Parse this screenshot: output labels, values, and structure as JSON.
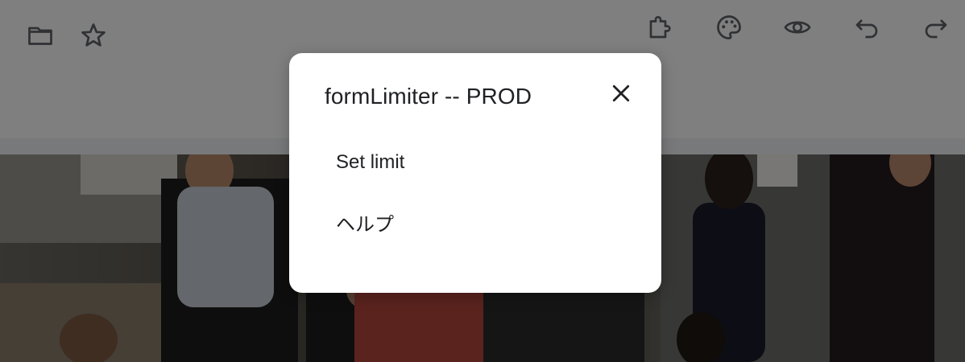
{
  "toolbar": {
    "left_icons": [
      "folder-icon",
      "star-icon"
    ],
    "right_icons": [
      "addon-puzzle-icon",
      "palette-icon",
      "preview-eye-icon",
      "undo-icon",
      "redo-icon"
    ]
  },
  "dialog": {
    "title": "formLimiter -- PROD",
    "close_icon": "close-icon",
    "items": [
      {
        "label": "Set limit"
      },
      {
        "label": "ヘルプ"
      }
    ]
  },
  "colors": {
    "scrim": "#000000",
    "dialog_bg": "#ffffff",
    "text": "#202124",
    "icon": "#5f6368"
  }
}
